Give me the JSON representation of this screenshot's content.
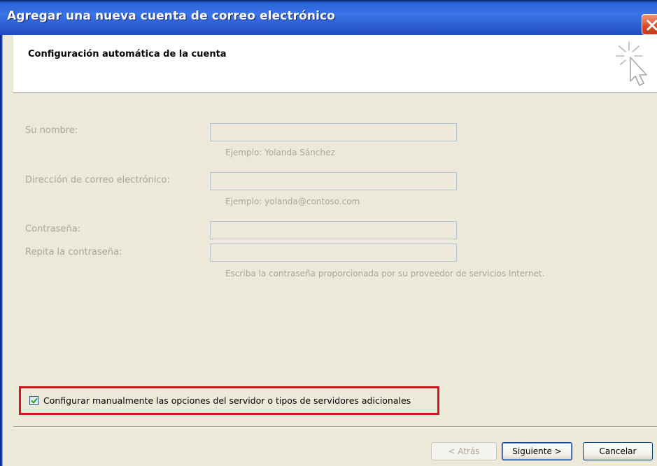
{
  "window": {
    "title": "Agregar una nueva cuenta de correo electrónico"
  },
  "header": {
    "title": "Configuración automática de la cuenta",
    "icon": "cursor-click-icon"
  },
  "form": {
    "name": {
      "label": "Su nombre:",
      "value": "",
      "hint": "Ejemplo: Yolanda Sánchez"
    },
    "email": {
      "label": "Dirección de correo electrónico:",
      "value": "",
      "hint": "Ejemplo: yolanda@contoso.com"
    },
    "password": {
      "label": "Contraseña:",
      "value": ""
    },
    "password_repeat": {
      "label": "Repita la contraseña:",
      "value": "",
      "hint": "Escriba la contraseña proporcionada por su proveedor de servicios Internet."
    }
  },
  "manual_config": {
    "label": "Configurar manualmente las opciones del servidor o tipos de servidores adicionales",
    "checked": true,
    "highlight_color": "#d0151c"
  },
  "buttons": {
    "back": "< Atrás",
    "next": "Siguiente >",
    "cancel": "Cancelar"
  },
  "colors": {
    "titlebar": "#2d5fd4",
    "dialog_bg": "#ece9d8",
    "disabled_text": "#a7a69a"
  }
}
